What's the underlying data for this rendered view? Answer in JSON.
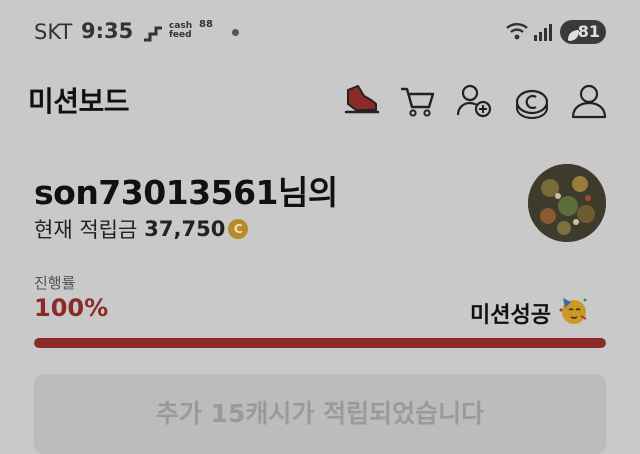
{
  "status_bar": {
    "carrier": "SKT",
    "time": "9:35",
    "notif_cashfeed": "cash feed",
    "notif_app": "88",
    "battery": "81"
  },
  "header": {
    "title": "미션보드",
    "icons": [
      "sneaker-icon",
      "cart-icon",
      "add-user-icon",
      "cash-coin-icon",
      "profile-icon"
    ]
  },
  "profile": {
    "username": "son73013561님의",
    "points_label": "현재 적립금",
    "points_value": "37,750",
    "coin_symbol": "C"
  },
  "progress": {
    "label": "진행률",
    "value_text": "100%",
    "percent": 100,
    "status": "미션성공"
  },
  "reward": {
    "text": "추가 15캐시가 적립되었습니다"
  },
  "colors": {
    "accent": "#8b2a26",
    "background": "#c9c9c9"
  }
}
